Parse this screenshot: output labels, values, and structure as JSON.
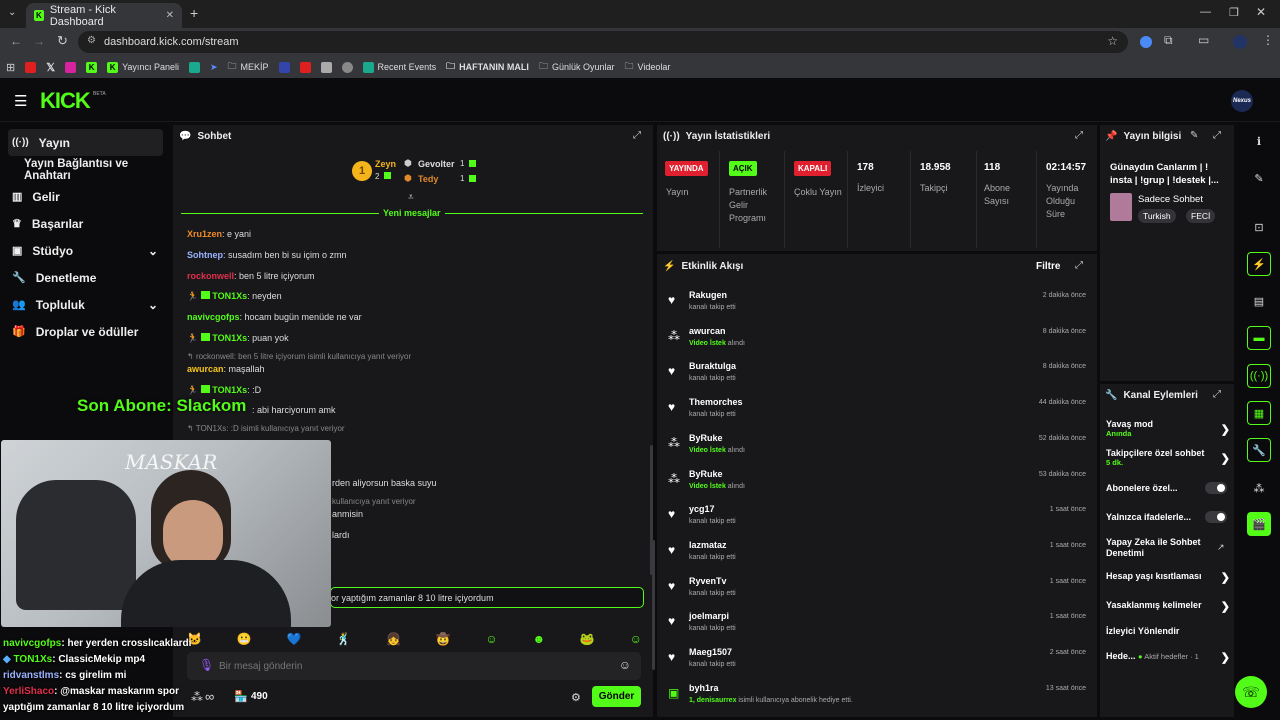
{
  "browser": {
    "tab_title": "Stream - Kick Dashboard",
    "url": "dashboard.kick.com/stream",
    "bookmarks": [
      "Yayıncı Paneli",
      "MEKİP",
      "Recent Events",
      "HAFTANIN MALI",
      "Günlük Oyunlar",
      "Videolar"
    ]
  },
  "header": {
    "logo": "KICK",
    "beta": "BETA",
    "avatar": "Nexus"
  },
  "sidebar": {
    "items": [
      {
        "label": "Yayın",
        "icon": "signal-icon"
      },
      {
        "label": "Yayın Bağlantısı ve Anahtarı",
        "icon": ""
      },
      {
        "label": "Gelir",
        "icon": "chart-icon"
      },
      {
        "label": "Başarılar",
        "icon": "trophy-icon"
      },
      {
        "label": "Stüdyo",
        "icon": "layout-icon"
      },
      {
        "label": "Denetleme",
        "icon": "wrench-icon"
      },
      {
        "label": "Topluluk",
        "icon": "people-icon"
      },
      {
        "label": "Droplar ve ödüller",
        "icon": "gift-icon"
      }
    ]
  },
  "chat": {
    "title": "Sohbet",
    "leaderboard": {
      "first_rank": "1",
      "first_name": "Zeyn",
      "first_count": "2",
      "second_name": "Gevolter",
      "second_count": "1",
      "third_name": "Tedy",
      "third_count": "1"
    },
    "new_messages": "Yeni mesajlar",
    "messages": [
      {
        "user": "Xru1zen",
        "text": ": e yani",
        "color": "#f08a24"
      },
      {
        "user": "Sohtnep",
        "text": ": susadım ben bi su içim o zmn",
        "color": "#9ab3ff"
      },
      {
        "user": "rockonwell",
        "text": ": ben 5 litre içiyorum",
        "color": "#e0304a"
      },
      {
        "user": "TON1Xs",
        "text": ": neyden",
        "color": "#53fc18"
      },
      {
        "user": "navivcgofps",
        "text": ": hocam bugün menüde ne var",
        "color": "#53fc18"
      },
      {
        "user": "TON1Xs",
        "text": ": puan yok",
        "color": "#53fc18"
      },
      {
        "user": "awurcan",
        "text": ": maşallah",
        "color": "#f5c518"
      },
      {
        "user": "TON1Xs",
        "text": ": :D",
        "color": "#53fc18"
      },
      {
        "user": "TON1Xs",
        "text": ": abi harciyorum amk",
        "color": "#53fc18"
      }
    ],
    "reply1": "rockonwell: ben 5 litre içiyorum isimli kullanıcıya yanıt veriyor",
    "reply2": "TON1Xs: :D isimli kullanıcıya yanıt veriyor",
    "partial": [
      "rden aliyorsun baska suyu",
      "kullanıcıya yanıt veriyor",
      "anmisin",
      "lardı"
    ],
    "input_value": "or yaptığım zamanlar 8 10 litre içiyordum",
    "placeholder": "Bir mesaj gönderin",
    "points": "490",
    "infinity": "∞",
    "send": "Gönder"
  },
  "overlay": {
    "son_abone": "Son Abone: Slackom",
    "cam_label": "MASKAR",
    "lines": [
      {
        "user": "navivcgofps",
        "text": ": her yerden crosslıcaklardı"
      },
      {
        "user": "TON1Xs",
        "text": ": ClassicMekip mp4"
      },
      {
        "user": "ridvanstlms",
        "text": ": cs girelim mi"
      },
      {
        "user": "YerliShaco",
        "text": ": @maskar maskarım spor"
      },
      {
        "user": "",
        "text": "yaptığım zamanlar 8 10 litre içiyordum"
      }
    ]
  },
  "stats": {
    "title": "Yayın İstatistikleri",
    "items": [
      {
        "badge": "YAYINDA",
        "badge_color": "#e0202e",
        "label": "Yayın"
      },
      {
        "badge": "AÇIK",
        "badge_color": "#53fc18",
        "label": "Partnerlik Gelir Programı"
      },
      {
        "badge": "KAPALI",
        "badge_color": "#e0202e",
        "label": "Çoklu Yayın"
      },
      {
        "value": "178",
        "label": "İzleyici"
      },
      {
        "value": "18.958",
        "label": "Takipçi"
      },
      {
        "value": "118",
        "label": "Abone Sayısı"
      },
      {
        "value": "02:14:57",
        "label": "Yayında Olduğu Süre"
      }
    ]
  },
  "info": {
    "title": "Yayın bilgisi",
    "stream_title": "Günaydın Canlarım | ! insta | !grup | !destek |...",
    "category": "Sadece Sohbet",
    "tags": [
      "Turkish",
      "FECİ"
    ]
  },
  "activity": {
    "title": "Etkinlik Akışı",
    "filter": "Filtre",
    "items": [
      {
        "name": "Rakugen",
        "sub": "kanalı takip etti",
        "time": "2 dakika önce",
        "type": "follow"
      },
      {
        "name": "awurcan",
        "sub_hi": "Video İstek",
        "sub": " alındı",
        "time": "8 dakika önce",
        "type": "reward"
      },
      {
        "name": "Buraktulga",
        "sub": "kanalı takip etti",
        "time": "8 dakika önce",
        "type": "follow"
      },
      {
        "name": "Themorches",
        "sub": "kanalı takip etti",
        "time": "44 dakika önce",
        "type": "follow"
      },
      {
        "name": "ByRuke",
        "sub_hi": "Video İstek",
        "sub": " alındı",
        "time": "52 dakika önce",
        "type": "reward"
      },
      {
        "name": "ByRuke",
        "sub_hi": "Video İstek",
        "sub": " alındı",
        "time": "53 dakika önce",
        "type": "reward"
      },
      {
        "name": "ycg17",
        "sub": "kanalı takip etti",
        "time": "1 saat önce",
        "type": "follow"
      },
      {
        "name": "lazmataz",
        "sub": "kanalı takip etti",
        "time": "1 saat önce",
        "type": "follow"
      },
      {
        "name": "RyvenTv",
        "sub": "kanalı takip etti",
        "time": "1 saat önce",
        "type": "follow"
      },
      {
        "name": "joelmarpi",
        "sub": "kanalı takip etti",
        "time": "1 saat önce",
        "type": "follow"
      },
      {
        "name": "Maeg1507",
        "sub": "kanalı takip etti",
        "time": "2 saat önce",
        "type": "follow"
      },
      {
        "name": "byh1ra",
        "sub_hi": "1, denisaurrex",
        "sub": " isimli kullanıcıya abonelik hediye etti.",
        "time": "13 saat önce",
        "type": "gift"
      }
    ]
  },
  "actions": {
    "title": "Kanal Eylemleri",
    "slow": "Yavaş mod",
    "slow_sub": "Anında",
    "follower": "Takipçilere özel sohbet",
    "follower_sub": "5 dk.",
    "subs": "Abonelere özel...",
    "emote": "Yalnızca ifadelerle...",
    "ai": "Yapay Zeka ile Sohbet Denetimi",
    "age": "Hesap yaşı kısıtlaması",
    "banned": "Yasaklanmış kelimeler",
    "redirect": "İzleyici Yönlendir",
    "goals": "Hede...",
    "goals_sub": "Aktif hedefler · 1"
  }
}
